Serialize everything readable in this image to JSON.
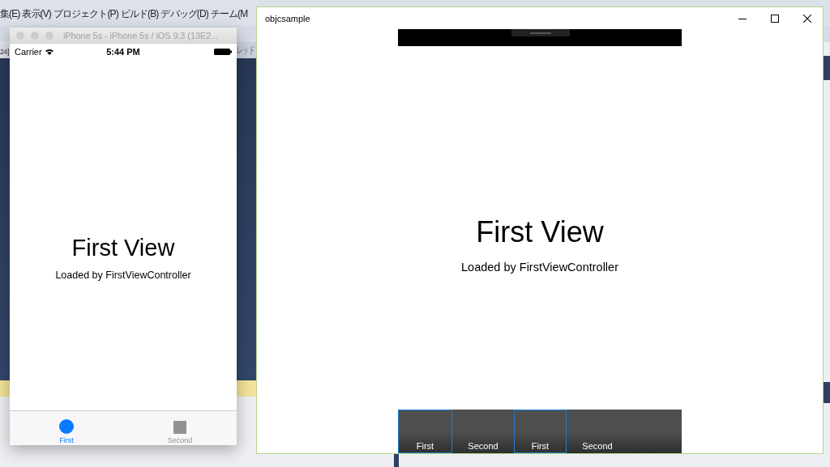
{
  "ide": {
    "menu": [
      "集(E)",
      "表示(V)",
      "プロジェクト(P)",
      "ビルド(B)",
      "デバッグ(D)",
      "チーム(M"
    ],
    "left_fragment": "24]",
    "right_fragment": "レッド"
  },
  "simulator": {
    "title": "iPhone 5s - iPhone 5s / iOS 9.3 (13E2...",
    "status_bar": {
      "carrier": "Carrier",
      "time": "5:44 PM"
    },
    "heading": "First View",
    "subtitle": "Loaded by FirstViewController",
    "tabs": [
      {
        "label": "First",
        "selected": true,
        "kind": "circle"
      },
      {
        "label": "Second",
        "selected": false,
        "kind": "square"
      }
    ]
  },
  "app_window": {
    "title": "objcsample",
    "heading": "First View",
    "subtitle": "Loaded by FirstViewController",
    "tabs": [
      {
        "label": "First",
        "highlighted": true
      },
      {
        "label": "Second",
        "highlighted": false
      },
      {
        "label": "First",
        "highlighted": true
      },
      {
        "label": "Second",
        "highlighted": false
      }
    ]
  }
}
